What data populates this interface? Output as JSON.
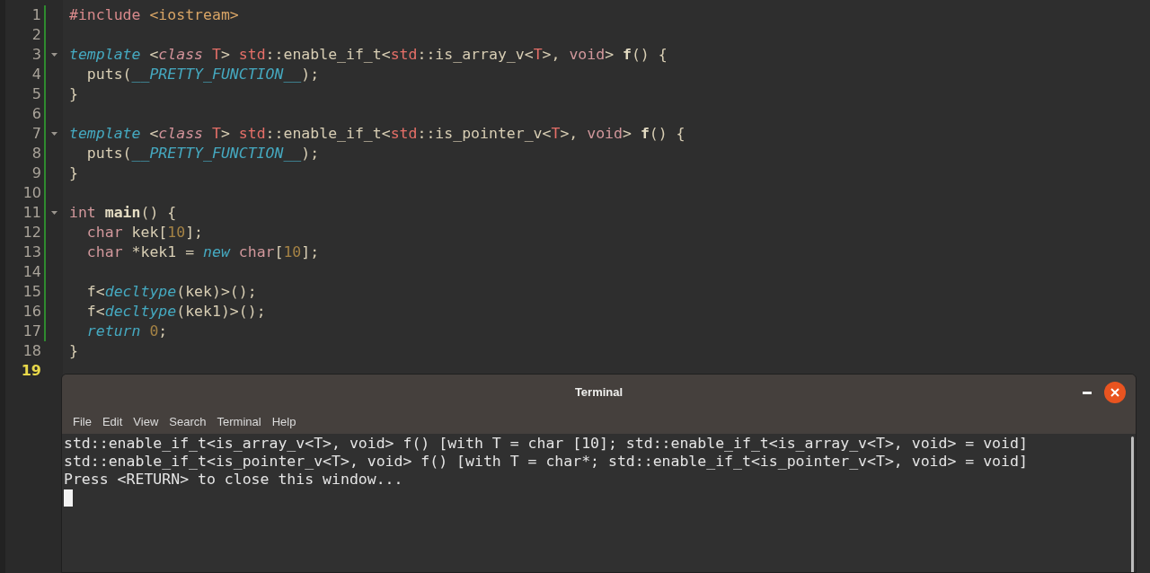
{
  "editor": {
    "lines": [
      {
        "number": "1",
        "modified": true,
        "fold": false,
        "current": false,
        "tokens": [
          {
            "text": "#include ",
            "kind": "pre"
          },
          {
            "text": "<iostream>",
            "kind": "inc"
          }
        ]
      },
      {
        "number": "2",
        "modified": true,
        "fold": false,
        "current": false
      },
      {
        "number": "3",
        "modified": true,
        "fold": true,
        "current": false,
        "tokens": [
          {
            "text": "template",
            "kind": "kw"
          },
          {
            "text": " <",
            "kind": "plain"
          },
          {
            "text": "class",
            "kind": "storage"
          },
          {
            "text": " T",
            "kind": "tparam"
          },
          {
            "text": "> ",
            "kind": "plain"
          },
          {
            "text": "std",
            "kind": "ns"
          },
          {
            "text": "::enable_if_t<",
            "kind": "plain"
          },
          {
            "text": "std",
            "kind": "ns"
          },
          {
            "text": "::is_array_v<",
            "kind": "plain"
          },
          {
            "text": "T",
            "kind": "tparam"
          },
          {
            "text": ">, ",
            "kind": "plain"
          },
          {
            "text": "void",
            "kind": "type"
          },
          {
            "text": "> ",
            "kind": "plain"
          },
          {
            "text": "f",
            "kind": "fn"
          },
          {
            "text": "() {",
            "kind": "plain"
          }
        ]
      },
      {
        "number": "4",
        "modified": true,
        "fold": false,
        "current": false,
        "tokens": [
          {
            "text": "  puts(",
            "kind": "plain"
          },
          {
            "text": "__PRETTY_FUNCTION__",
            "kind": "kw"
          },
          {
            "text": ");",
            "kind": "plain"
          }
        ]
      },
      {
        "number": "5",
        "modified": true,
        "fold": false,
        "current": false,
        "tokens": [
          {
            "text": "}",
            "kind": "plain"
          }
        ]
      },
      {
        "number": "6",
        "modified": true,
        "fold": false,
        "current": false
      },
      {
        "number": "7",
        "modified": true,
        "fold": true,
        "current": false,
        "tokens": [
          {
            "text": "template",
            "kind": "kw"
          },
          {
            "text": " <",
            "kind": "plain"
          },
          {
            "text": "class",
            "kind": "storage"
          },
          {
            "text": " T",
            "kind": "tparam"
          },
          {
            "text": "> ",
            "kind": "plain"
          },
          {
            "text": "std",
            "kind": "ns"
          },
          {
            "text": "::enable_if_t<",
            "kind": "plain"
          },
          {
            "text": "std",
            "kind": "ns"
          },
          {
            "text": "::is_pointer_v<",
            "kind": "plain"
          },
          {
            "text": "T",
            "kind": "tparam"
          },
          {
            "text": ">, ",
            "kind": "plain"
          },
          {
            "text": "void",
            "kind": "type"
          },
          {
            "text": "> ",
            "kind": "plain"
          },
          {
            "text": "f",
            "kind": "fn"
          },
          {
            "text": "() {",
            "kind": "plain"
          }
        ]
      },
      {
        "number": "8",
        "modified": true,
        "fold": false,
        "current": false,
        "tokens": [
          {
            "text": "  puts(",
            "kind": "plain"
          },
          {
            "text": "__PRETTY_FUNCTION__",
            "kind": "kw"
          },
          {
            "text": ");",
            "kind": "plain"
          }
        ]
      },
      {
        "number": "9",
        "modified": true,
        "fold": false,
        "current": false,
        "tokens": [
          {
            "text": "}",
            "kind": "plain"
          }
        ]
      },
      {
        "number": "10",
        "modified": true,
        "fold": false,
        "current": false
      },
      {
        "number": "11",
        "modified": true,
        "fold": true,
        "current": false,
        "tokens": [
          {
            "text": "int",
            "kind": "type"
          },
          {
            "text": " main",
            "kind": "fn"
          },
          {
            "text": "() {",
            "kind": "plain"
          }
        ]
      },
      {
        "number": "12",
        "modified": true,
        "fold": false,
        "current": false,
        "tokens": [
          {
            "text": "  char",
            "kind": "type"
          },
          {
            "text": " kek[",
            "kind": "plain"
          },
          {
            "text": "10",
            "kind": "num"
          },
          {
            "text": "];",
            "kind": "plain"
          }
        ]
      },
      {
        "number": "13",
        "modified": true,
        "fold": false,
        "current": false,
        "tokens": [
          {
            "text": "  char",
            "kind": "type"
          },
          {
            "text": " *kek1 = ",
            "kind": "plain"
          },
          {
            "text": "new",
            "kind": "kw"
          },
          {
            "text": " char",
            "kind": "type"
          },
          {
            "text": "[",
            "kind": "plain"
          },
          {
            "text": "10",
            "kind": "num"
          },
          {
            "text": "];",
            "kind": "plain"
          }
        ]
      },
      {
        "number": "14",
        "modified": true,
        "fold": false,
        "current": false
      },
      {
        "number": "15",
        "modified": true,
        "fold": false,
        "current": false,
        "tokens": [
          {
            "text": "  f<",
            "kind": "plain"
          },
          {
            "text": "decltype",
            "kind": "kw"
          },
          {
            "text": "(kek)>();",
            "kind": "plain"
          }
        ]
      },
      {
        "number": "16",
        "modified": true,
        "fold": false,
        "current": false,
        "tokens": [
          {
            "text": "  f<",
            "kind": "plain"
          },
          {
            "text": "decltype",
            "kind": "kw"
          },
          {
            "text": "(kek1)>();",
            "kind": "plain"
          }
        ]
      },
      {
        "number": "17",
        "modified": true,
        "fold": false,
        "current": false,
        "tokens": [
          {
            "text": "  return",
            "kind": "kw"
          },
          {
            "text": " 0",
            "kind": "num"
          },
          {
            "text": ";",
            "kind": "plain"
          }
        ]
      },
      {
        "number": "18",
        "modified": false,
        "fold": false,
        "current": false,
        "tokens": [
          {
            "text": "}",
            "kind": "plain"
          }
        ]
      },
      {
        "number": "19",
        "modified": false,
        "fold": false,
        "current": true
      }
    ]
  },
  "terminal": {
    "title": "Terminal",
    "menu": [
      "File",
      "Edit",
      "View",
      "Search",
      "Terminal",
      "Help"
    ],
    "output": [
      "std::enable_if_t<is_array_v<T>, void> f() [with T = char [10]; std::enable_if_t<is_array_v<T>, void> = void]",
      "std::enable_if_t<is_pointer_v<T>, void> f() [with T = char*; std::enable_if_t<is_pointer_v<T>, void> = void]",
      "Press <RETURN> to close this window..."
    ]
  }
}
